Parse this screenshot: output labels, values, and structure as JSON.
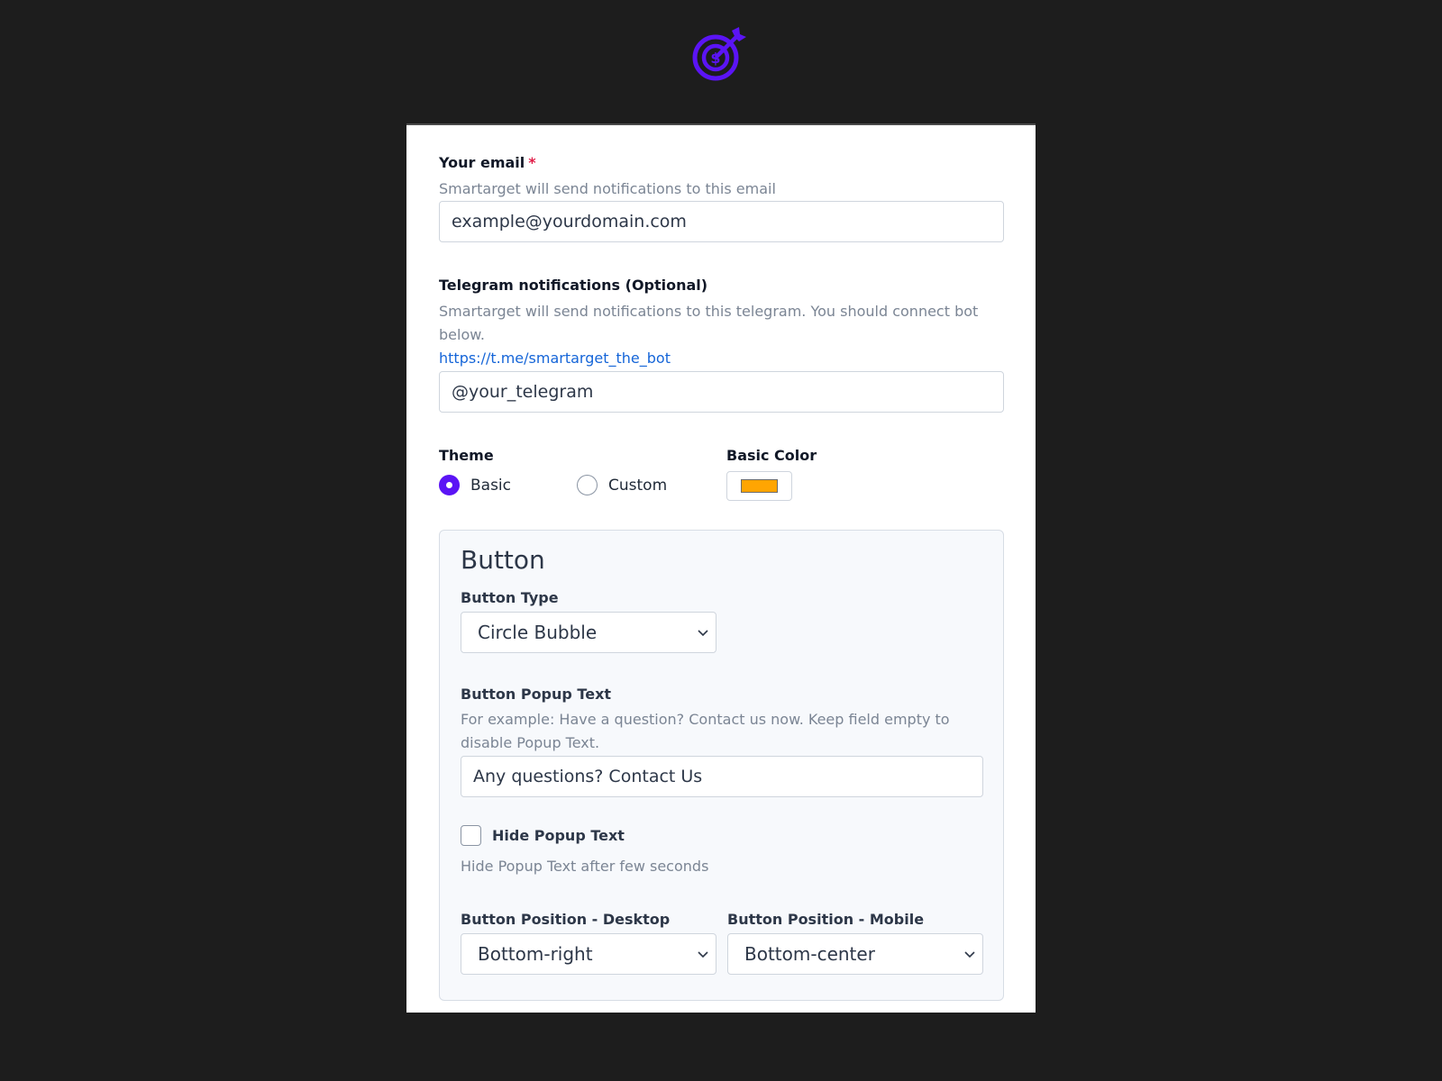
{
  "brand": {
    "accent": "#5b14f5",
    "logo_icon": "target-dollar-logo"
  },
  "email": {
    "label": "Your email",
    "required_mark": "*",
    "help": "Smartarget will send notifications to this email",
    "value": "example@yourdomain.com"
  },
  "telegram": {
    "label": "Telegram notifications (Optional)",
    "help": "Smartarget will send notifications to this telegram. You should connect bot below.",
    "link": "https://t.me/smartarget_the_bot",
    "value": "@your_telegram"
  },
  "theme": {
    "label": "Theme",
    "options": [
      {
        "label": "Basic",
        "checked": true
      },
      {
        "label": "Custom",
        "checked": false
      }
    ],
    "color_label": "Basic Color",
    "color": "#ffa502"
  },
  "button_section": {
    "title": "Button",
    "type_label": "Button Type",
    "type_value": "Circle Bubble",
    "popup_label": "Button Popup Text",
    "popup_help": "For example: Have a question? Contact us now. Keep field empty to disable Popup Text.",
    "popup_value": "Any questions? Contact Us",
    "hide_label": "Hide Popup Text",
    "hide_checked": false,
    "hide_help": "Hide Popup Text after few seconds",
    "desktop_label": "Button Position - Desktop",
    "desktop_value": "Bottom-right",
    "mobile_label": "Button Position - Mobile",
    "mobile_value": "Bottom-center"
  }
}
